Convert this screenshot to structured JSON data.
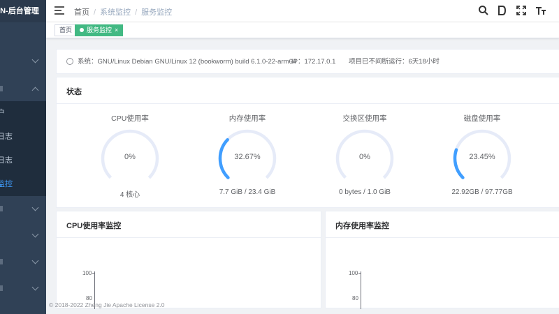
{
  "sidebar": {
    "brand": "RuoYi-Vue-PLUS-后台管理",
    "brand_visible": "IIN-后台管理",
    "items": [
      {
        "icon": "chevron-down-icon"
      },
      {
        "icon": "chevron-up-icon"
      },
      {
        "icon": "chevron-down-icon"
      },
      {
        "icon": "chevron-down-icon"
      },
      {
        "icon": "chevron-down-icon"
      },
      {
        "icon": "chevron-down-icon"
      }
    ],
    "sub_items": [
      "户",
      "日志",
      "日志",
      "监控"
    ]
  },
  "navbar": {
    "breadcrumb": [
      "首页",
      "系统监控",
      "服务监控"
    ],
    "icons": [
      "search-icon",
      "document-icon",
      "fullscreen-icon",
      "font-size-icon"
    ]
  },
  "tags": {
    "home": "首页",
    "active": "服务监控",
    "close": "×"
  },
  "sysinfo": {
    "system": "系统：GNU/Linux Debian GNU/Linux 12 (bookworm) build 6.1.0-22-arm64",
    "ip": "IP：172.17.0.1",
    "uptime": "项目已不间断运行：6天18小时"
  },
  "status": {
    "title": "状态",
    "gauges": [
      {
        "title": "CPU使用率",
        "value_text": "0%",
        "percent": 0,
        "footer": "4 核心"
      },
      {
        "title": "内存使用率",
        "value_text": "32.67%",
        "percent": 32.67,
        "footer": "7.7 GiB / 23.4 GiB"
      },
      {
        "title": "交换区使用率",
        "value_text": "0%",
        "percent": 0,
        "footer": "0 bytes / 1.0 GiB"
      },
      {
        "title": "磁盘使用率",
        "value_text": "23.45%",
        "percent": 23.45,
        "footer": "22.92GB / 97.77GB"
      }
    ]
  },
  "cpu_monitor": {
    "title": "CPU使用率监控",
    "y_ticks": [
      "100",
      "80"
    ]
  },
  "mem_monitor": {
    "title": "内存使用率监控",
    "y_ticks": [
      "100",
      "80"
    ]
  },
  "footer": "© 2018-2022 Zheng Jie Apache License 2.0",
  "colors": {
    "sidebar_bg": "#304156",
    "accent": "#409eff",
    "tag_active": "#42b983",
    "gauge_track": "#e6ebf8"
  }
}
